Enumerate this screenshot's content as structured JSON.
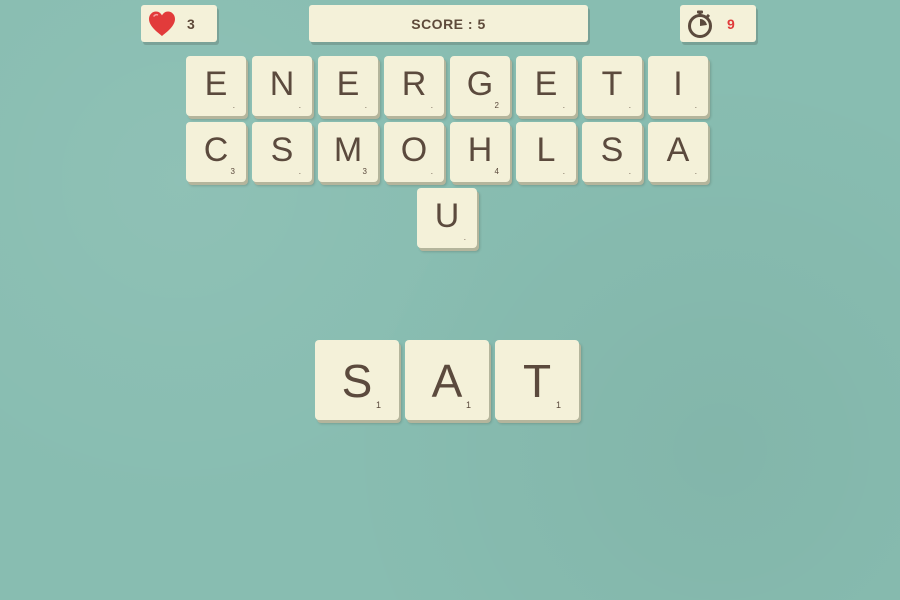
{
  "hud": {
    "lives_icon": "heart-icon",
    "lives": "3",
    "score_text": "SCORE : 5",
    "timer_icon": "stopwatch-icon",
    "timer": "9",
    "colors": {
      "background": "#88bdb1",
      "tile": "#f4f1d9",
      "text": "#5b4a3d",
      "heart": "#e23b3b",
      "timer_value": "#e03a3a"
    }
  },
  "board": {
    "tiles": [
      {
        "letter": "E",
        "points": "."
      },
      {
        "letter": "N",
        "points": "."
      },
      {
        "letter": "E",
        "points": "."
      },
      {
        "letter": "R",
        "points": "."
      },
      {
        "letter": "G",
        "points": "2"
      },
      {
        "letter": "E",
        "points": "."
      },
      {
        "letter": "T",
        "points": "."
      },
      {
        "letter": "I",
        "points": "."
      },
      {
        "letter": "C",
        "points": "3"
      },
      {
        "letter": "S",
        "points": "."
      },
      {
        "letter": "M",
        "points": "3"
      },
      {
        "letter": "O",
        "points": "."
      },
      {
        "letter": "H",
        "points": "4"
      },
      {
        "letter": "L",
        "points": "."
      },
      {
        "letter": "S",
        "points": "."
      },
      {
        "letter": "A",
        "points": "."
      },
      {
        "letter": "U",
        "points": "."
      }
    ]
  },
  "word": {
    "tiles": [
      {
        "letter": "S",
        "points": "1"
      },
      {
        "letter": "A",
        "points": "1"
      },
      {
        "letter": "T",
        "points": "1"
      }
    ]
  }
}
